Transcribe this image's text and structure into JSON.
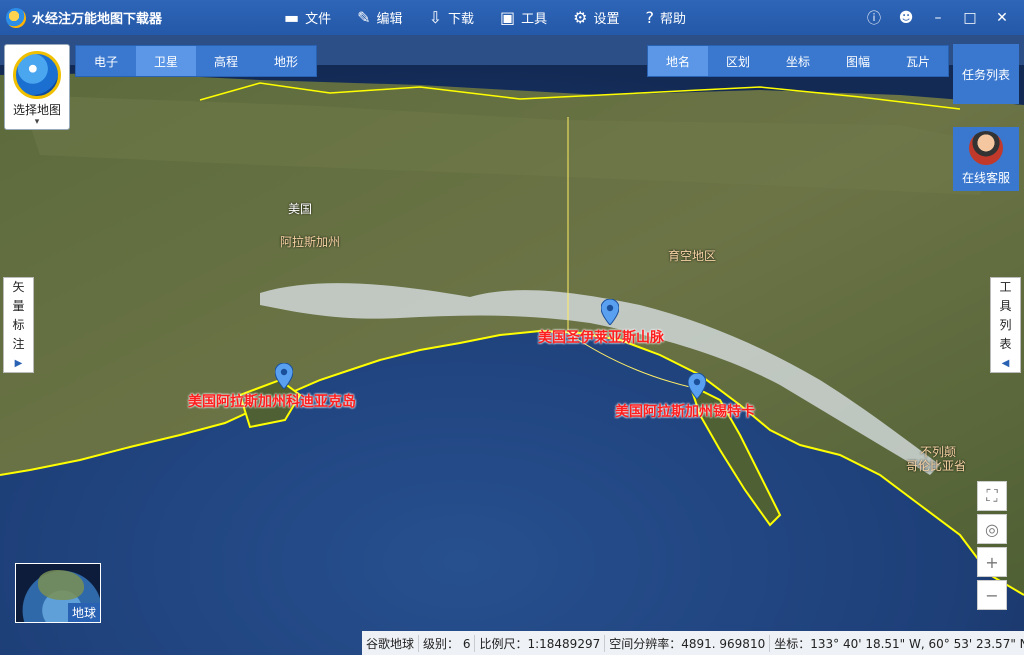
{
  "app": {
    "title": "水经注万能地图下载器",
    "logo_icon": "globe-logo-icon"
  },
  "menu": [
    {
      "label": "文件",
      "icon": "folder-icon",
      "glyph": "▬"
    },
    {
      "label": "编辑",
      "icon": "edit-icon",
      "glyph": "✎"
    },
    {
      "label": "下载",
      "icon": "download-icon",
      "glyph": "⇩"
    },
    {
      "label": "工具",
      "icon": "toolbox-icon",
      "glyph": "▣"
    },
    {
      "label": "设置",
      "icon": "gear-icon",
      "glyph": "⚙"
    },
    {
      "label": "帮助",
      "icon": "help-icon",
      "glyph": "?"
    }
  ],
  "window_controls": [
    {
      "name": "info-icon",
      "glyph": "ⓘ"
    },
    {
      "name": "user-icon",
      "glyph": "☻"
    },
    {
      "name": "minimize-icon",
      "glyph": "–"
    },
    {
      "name": "maximize-icon",
      "glyph": "□"
    },
    {
      "name": "close-icon",
      "glyph": "✕"
    }
  ],
  "map_types": [
    {
      "label": "电子",
      "active": false
    },
    {
      "label": "卫星",
      "active": true
    },
    {
      "label": "高程",
      "active": false
    },
    {
      "label": "地形",
      "active": false
    }
  ],
  "overlay_types": [
    {
      "label": "地名",
      "active": true
    },
    {
      "label": "区划",
      "active": false
    },
    {
      "label": "坐标",
      "active": false
    },
    {
      "label": "图幅",
      "active": false
    },
    {
      "label": "瓦片",
      "active": false
    }
  ],
  "select_map": {
    "label": "选择地图",
    "caret": "▾"
  },
  "task_list": {
    "label": "任务列表"
  },
  "online_service": {
    "label": "在线客服"
  },
  "vector_annotation": {
    "chars": [
      "矢",
      "量",
      "标",
      "注"
    ],
    "arrow": "▶"
  },
  "tool_list": {
    "chars": [
      "工",
      "具",
      "列",
      "表"
    ],
    "arrow": "◀"
  },
  "map_controls": [
    {
      "name": "fullscreen-button",
      "glyph": "⛶"
    },
    {
      "name": "locate-button",
      "glyph": "◎"
    },
    {
      "name": "zoom-in-button",
      "glyph": "+"
    },
    {
      "name": "zoom-out-button",
      "glyph": "−"
    }
  ],
  "minimap": {
    "label": "地球"
  },
  "map_labels": {
    "country_usa": "美国",
    "state_alaska": "阿拉斯加州",
    "yukon": "育空地区",
    "bc_line1": "不列颠",
    "bc_line2": "哥伦比亚省"
  },
  "markers": [
    {
      "label": "美国圣伊莱亚斯山脉"
    },
    {
      "label": "美国阿拉斯加州科迪亚克岛"
    },
    {
      "label": "美国阿拉斯加州锡特卡"
    }
  ],
  "status": {
    "source": "谷歌地球",
    "level": "级别：  6",
    "scale": "比例尺：1:18489297",
    "resolution": "空间分辨率：4891. 969810",
    "coords": "坐标：133° 40' 18.51\" W, 60° 53' 23.57\" N"
  },
  "colors": {
    "title_bar": "#2a5fae",
    "tab_active": "#5b97e6",
    "tab_bg": "#3a78d0",
    "marker_text": "#ff1e1e",
    "coastline": "#ffff00",
    "pin": "#5aa0f0"
  }
}
